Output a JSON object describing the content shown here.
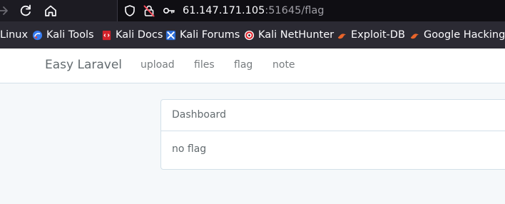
{
  "browser": {
    "url_host": "61.147.171.105",
    "url_rest": ":51645/flag",
    "bookmarks": [
      {
        "label": "Linux",
        "icon": "kali-linux-icon"
      },
      {
        "label": "Kali Tools",
        "icon": "kali-tools-icon"
      },
      {
        "label": "Kali Docs",
        "icon": "kali-docs-icon"
      },
      {
        "label": "Kali Forums",
        "icon": "kali-forums-icon"
      },
      {
        "label": "Kali NetHunter",
        "icon": "kali-nethunter-icon"
      },
      {
        "label": "Exploit-DB",
        "icon": "exploit-db-icon"
      },
      {
        "label": "Google Hacking DB",
        "icon": "google-hacking-db-icon"
      }
    ]
  },
  "site": {
    "brand": "Easy Laravel",
    "nav": [
      "upload",
      "files",
      "flag",
      "note"
    ]
  },
  "panel": {
    "heading": "Dashboard",
    "body": "no flag"
  },
  "colors": {
    "chrome_toolbar": "#1c1b22",
    "urlbar": "#0f0e13",
    "bookmarks_bar": "#2b2a33",
    "page_background": "#f5f8fa",
    "panel_border": "#d3e0e9",
    "text": "#636b6f"
  }
}
